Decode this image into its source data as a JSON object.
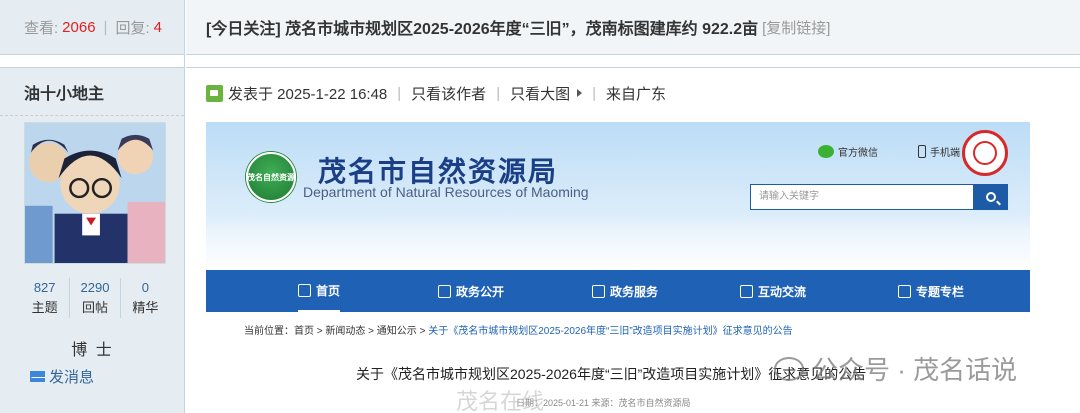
{
  "stats": {
    "views_label": "查看:",
    "views": "2066",
    "replies_label": "回复:",
    "replies": "4"
  },
  "thread": {
    "title": "[今日关注] 茂名市城市规划区2025-2026年度“三旧”，茂南标图建库约 922.2亩",
    "copy_link": "[复制链接]"
  },
  "author": {
    "name": "油十小地主",
    "topics": "827",
    "topics_label": "主题",
    "posts": "2290",
    "posts_label": "回帖",
    "digest": "0",
    "digest_label": "精华",
    "rank": "博 士",
    "message": "发消息"
  },
  "post_meta": {
    "posted": "发表于 2025-1-22 16:48",
    "author_only": "只看该作者",
    "big_image": "只看大图",
    "from": "来自广东"
  },
  "embed": {
    "logo_text": "茂名自然资源",
    "site_name_cn": "茂名市自然资源局",
    "site_name_en": "Department of Natural Resources of Maoming",
    "wechat": "官方微信",
    "mobile": "手机端",
    "search_placeholder": "请输入关键字",
    "nav": [
      "首页",
      "政务公开",
      "政务服务",
      "互动交流",
      "专题专栏"
    ],
    "breadcrumb_prefix": "当前位置：首页 > 新闻动态 > 通知公示 >",
    "breadcrumb_current": "关于《茂名市城市规划区2025-2026年度“三旧”改造项目实施计划》征求意见的公告",
    "article_title": "关于《茂名市城市规划区2025-2026年度“三旧”改造项目实施计划》征求意见的公告",
    "article_meta": "日期：2025-01-21 来源：茂名市自然资源局",
    "watermark": "公众号 · 茂名话说",
    "watermark2": "茂名在线"
  },
  "colors": {
    "accent_red": "#e02020",
    "link_blue": "#336699",
    "nav_blue": "#1f62b5",
    "sidebar_bg": "#e5edf2"
  }
}
